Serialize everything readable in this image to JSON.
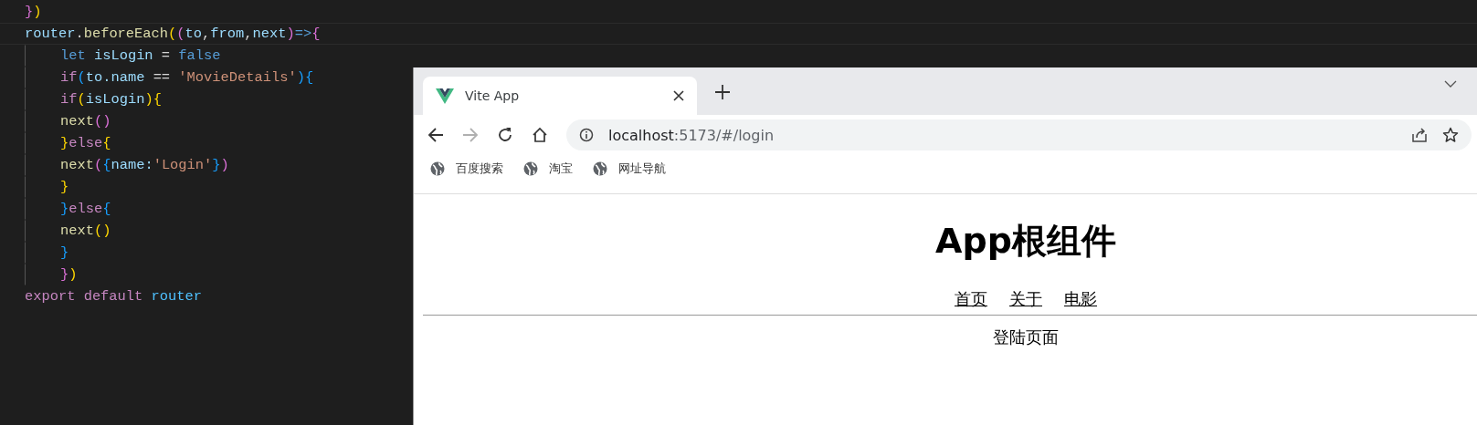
{
  "editor": {
    "lines": [
      {
        "indented": false,
        "current": false,
        "tokens": [
          {
            "text": "}",
            "kind": "bracket-2"
          },
          {
            "text": ")",
            "kind": "bracket-1"
          }
        ]
      },
      {
        "indented": false,
        "current": true,
        "tokens": [
          {
            "text": "router",
            "kind": "variable"
          },
          {
            "text": ".",
            "kind": "operator"
          },
          {
            "text": "beforeEach",
            "kind": "function"
          },
          {
            "text": "(",
            "kind": "bracket-1"
          },
          {
            "text": "(",
            "kind": "bracket-2"
          },
          {
            "text": "to",
            "kind": "variable"
          },
          {
            "text": ",",
            "kind": "operator"
          },
          {
            "text": "from",
            "kind": "variable"
          },
          {
            "text": ",",
            "kind": "operator"
          },
          {
            "text": "next",
            "kind": "variable"
          },
          {
            "text": ")",
            "kind": "bracket-2"
          },
          {
            "text": "=>",
            "kind": "keyword"
          },
          {
            "text": "{",
            "kind": "bracket-2"
          }
        ]
      },
      {
        "indented": true,
        "current": false,
        "tokens": [
          {
            "text": "let",
            "kind": "keyword"
          },
          {
            "text": " isLogin",
            "kind": "variable"
          },
          {
            "text": " = ",
            "kind": "operator"
          },
          {
            "text": "false",
            "kind": "keyword"
          }
        ]
      },
      {
        "indented": true,
        "current": false,
        "tokens": [
          {
            "text": "if",
            "kind": "control"
          },
          {
            "text": "(",
            "kind": "bracket-3"
          },
          {
            "text": "to.name",
            "kind": "variable"
          },
          {
            "text": " == ",
            "kind": "operator"
          },
          {
            "text": "'MovieDetails'",
            "kind": "string"
          },
          {
            "text": ")",
            "kind": "bracket-3"
          },
          {
            "text": "{",
            "kind": "bracket-3"
          }
        ]
      },
      {
        "indented": true,
        "current": false,
        "tokens": [
          {
            "text": "if",
            "kind": "control"
          },
          {
            "text": "(",
            "kind": "bracket-1"
          },
          {
            "text": "isLogin",
            "kind": "variable"
          },
          {
            "text": ")",
            "kind": "bracket-1"
          },
          {
            "text": "{",
            "kind": "bracket-1"
          }
        ]
      },
      {
        "indented": true,
        "current": false,
        "tokens": [
          {
            "text": "next",
            "kind": "function"
          },
          {
            "text": "()",
            "kind": "bracket-2"
          }
        ]
      },
      {
        "indented": true,
        "current": false,
        "tokens": [
          {
            "text": "}",
            "kind": "bracket-1"
          },
          {
            "text": "else",
            "kind": "control"
          },
          {
            "text": "{",
            "kind": "bracket-1"
          }
        ]
      },
      {
        "indented": true,
        "current": false,
        "tokens": [
          {
            "text": "next",
            "kind": "function"
          },
          {
            "text": "(",
            "kind": "bracket-2"
          },
          {
            "text": "{",
            "kind": "bracket-3"
          },
          {
            "text": "name:",
            "kind": "variable"
          },
          {
            "text": "'Login'",
            "kind": "string"
          },
          {
            "text": "}",
            "kind": "bracket-3"
          },
          {
            "text": ")",
            "kind": "bracket-2"
          }
        ]
      },
      {
        "indented": true,
        "current": false,
        "tokens": [
          {
            "text": "}",
            "kind": "bracket-1"
          }
        ]
      },
      {
        "indented": true,
        "current": false,
        "tokens": [
          {
            "text": "}",
            "kind": "bracket-3"
          },
          {
            "text": "else",
            "kind": "control"
          },
          {
            "text": "{",
            "kind": "bracket-3"
          }
        ]
      },
      {
        "indented": true,
        "current": false,
        "tokens": [
          {
            "text": "next",
            "kind": "function"
          },
          {
            "text": "()",
            "kind": "bracket-1"
          }
        ]
      },
      {
        "indented": true,
        "current": false,
        "tokens": [
          {
            "text": "}",
            "kind": "bracket-3"
          }
        ]
      },
      {
        "indented": true,
        "current": false,
        "tokens": [
          {
            "text": "}",
            "kind": "bracket-2"
          },
          {
            "text": ")",
            "kind": "bracket-1"
          }
        ]
      },
      {
        "indented": false,
        "current": false,
        "tokens": [
          {
            "text": "export default",
            "kind": "control"
          },
          {
            "text": " router",
            "kind": "variable-bright"
          }
        ]
      }
    ]
  },
  "browser": {
    "tabs": [
      {
        "title": "Vite App",
        "selected": true
      }
    ],
    "toolbar": {
      "back_disabled": false,
      "forward_disabled": true
    },
    "address": {
      "host": "localhost",
      "rest": ":5173/#/login"
    },
    "bookmarks": [
      {
        "label": "百度搜索"
      },
      {
        "label": "淘宝"
      },
      {
        "label": "网址导航"
      }
    ],
    "page": {
      "heading": "App根组件",
      "nav": [
        {
          "label": "首页"
        },
        {
          "label": "关于"
        },
        {
          "label": "电影"
        }
      ],
      "content": "登陆页面"
    }
  }
}
